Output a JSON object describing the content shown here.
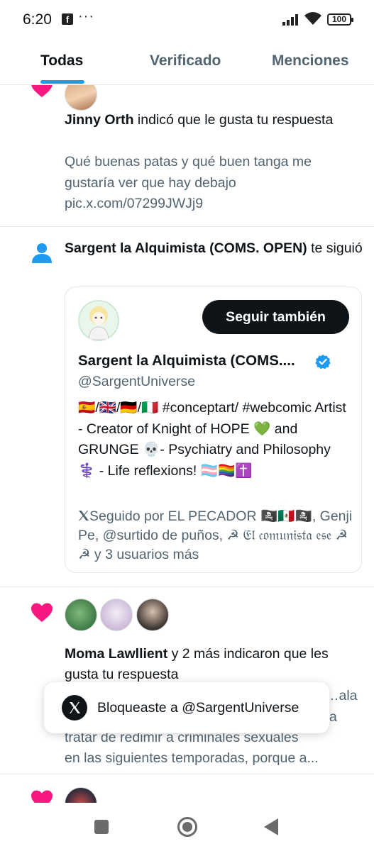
{
  "status": {
    "time": "6:20",
    "facebook_glyph": "f",
    "more_glyph": "···",
    "battery": "100"
  },
  "tabs": [
    {
      "label": "Todas",
      "active": true
    },
    {
      "label": "Verificado",
      "active": false
    },
    {
      "label": "Menciones",
      "active": false
    }
  ],
  "notifications": {
    "like1": {
      "icon": "heart-icon",
      "user": "Jinny Orth",
      "action": " indicó que le gusta tu respuesta",
      "snippet": "Qué buenas patas y qué buen tanga me gustaría ver que hay debajo pic.x.com/07299JWJj9"
    },
    "follow": {
      "icon": "person-icon",
      "user": "Sargent la Alquimista (COMS. OPEN)",
      "action": " te siguió",
      "card": {
        "follow_button": "Seguir también",
        "name": "Sargent la Alquimista (COMS....",
        "handle": "@SargentUniverse",
        "bio": "🇪🇸/🇬🇧/🇩🇪/🇮🇹 #conceptart/ #webcomic Artist - Creator of Knight of HOPE 💚 and GRUNGE 💀- Psychiatry and Philosophy ⚕️ - Life reflexions! 🏳️‍⚧️🏳️‍🌈✝️",
        "followed_by": "Seguido por EL PECADOR 🏴‍☠️🇲🇽🏴‍☠️, Genji Pe, @surtido de puños, ☭ 𝔈𝔩 𝔠𝔬𝔪𝔲𝔫𝔦𝔰𝔱𝔞 𝔢𝔰𝔢 ☭ ☭ y 3 usuarios más"
      }
    },
    "like2": {
      "icon": "heart-icon",
      "user": "Moma Lawllient",
      "action": " y 2 más indicaron que les gusta tu respuesta",
      "snippet_partial_1": "…ala",
      "snippet_partial_2": "a",
      "snippet_line3": "tratar de redimir a criminales sexuales",
      "snippet_line4": "en las siguientes temporadas, porque a..."
    }
  },
  "toast": {
    "text": "Bloqueaste a @SargentUniverse"
  },
  "colors": {
    "accent": "#1d9bf0",
    "heart": "#f91880",
    "text_primary": "#0f1419",
    "text_secondary": "#536471"
  }
}
